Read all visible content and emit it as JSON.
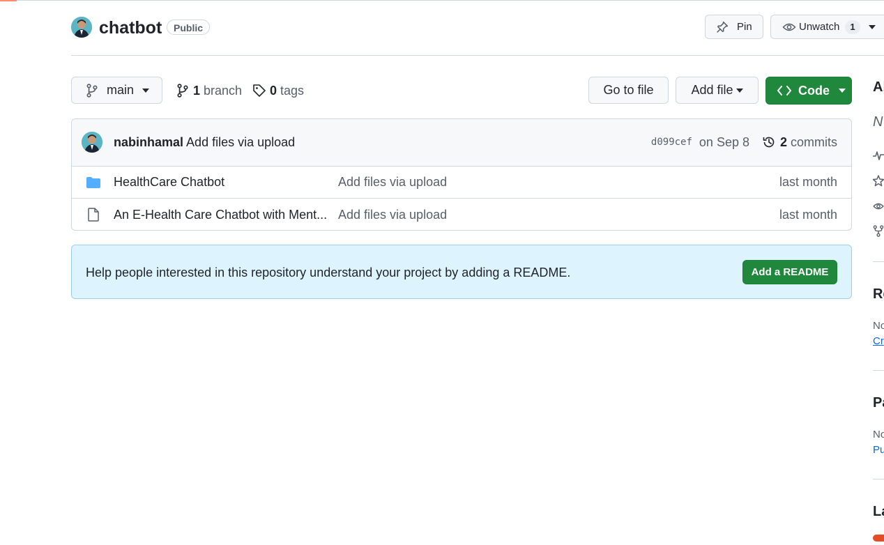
{
  "repo": {
    "name": "chatbot",
    "visibility": "Public"
  },
  "actions": {
    "pin_label": "Pin",
    "watch_label": "Unwatch",
    "watch_count": "1"
  },
  "toolbar": {
    "branch_selected": "main",
    "branch_count": "1",
    "branch_label": "branch",
    "tag_count": "0",
    "tag_label": "tags",
    "go_to_file": "Go to file",
    "add_file": "Add file",
    "code": "Code"
  },
  "latest_commit": {
    "author": "nabinhamal",
    "message": "Add files via upload",
    "sha": "d099cef",
    "date": "on Sep 8",
    "commit_count": "2",
    "commit_label": "commits"
  },
  "files": [
    {
      "type": "folder",
      "name": "HealthCare Chatbot",
      "message": "Add files via upload",
      "age": "last month"
    },
    {
      "type": "file",
      "name": "An E-Health Care Chatbot with Ment...",
      "message": "Add files via upload",
      "age": "last month"
    }
  ],
  "readme_banner": {
    "text": "Help people interested in this repository understand your project by adding a README.",
    "button": "Add a README"
  },
  "sidebar": {
    "about_heading": "Ab",
    "about_desc": "N",
    "releases_heading": "Re",
    "releases_text": "No",
    "releases_link": "Cr",
    "packages_heading": "Pa",
    "packages_text": "No",
    "packages_link": "Pu",
    "languages_heading": "La"
  },
  "colors": {
    "primary_green": "#1f883d",
    "link_blue": "#0969da",
    "folder_blue": "#54aeff",
    "banner_bg": "#ddf4ff"
  }
}
